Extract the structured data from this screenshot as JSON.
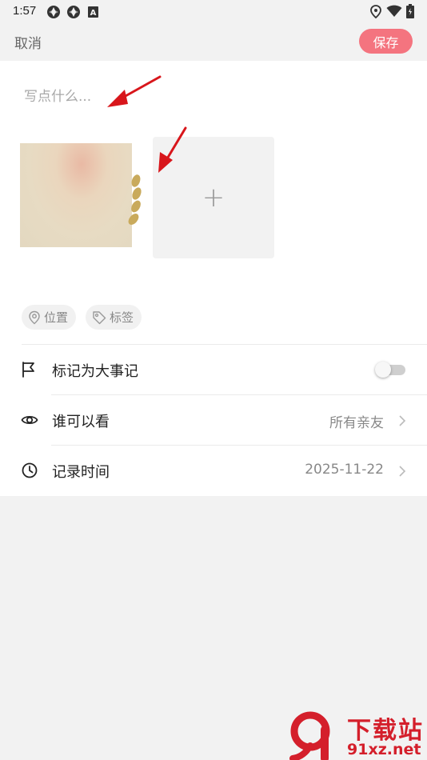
{
  "status_bar": {
    "time": "1:57",
    "icons": [
      "sync-icon",
      "sync-icon",
      "a-badge-icon",
      "location-icon",
      "wifi-icon",
      "battery-icon"
    ]
  },
  "header": {
    "cancel_label": "取消",
    "save_label": "保存"
  },
  "editor": {
    "placeholder": "写点什么...",
    "value": ""
  },
  "photos": {
    "add_glyph": "+"
  },
  "chips": [
    {
      "label": "位置",
      "icon": "location-pin-icon"
    },
    {
      "label": "标签",
      "icon": "tag-icon"
    }
  ],
  "settings": {
    "milestone": {
      "label": "标记为大事记",
      "icon": "flag-icon",
      "enabled": false
    },
    "visibility": {
      "label": "谁可以看",
      "value": "所有亲友",
      "icon": "eye-icon"
    },
    "record_time": {
      "label": "记录时间",
      "value": "2025-11-22",
      "icon": "clock-icon"
    }
  },
  "watermark": {
    "brand": "下载站",
    "site": "91xz.net"
  },
  "colors": {
    "accent": "#f4747f",
    "annotation_arrow": "#d8161b"
  }
}
